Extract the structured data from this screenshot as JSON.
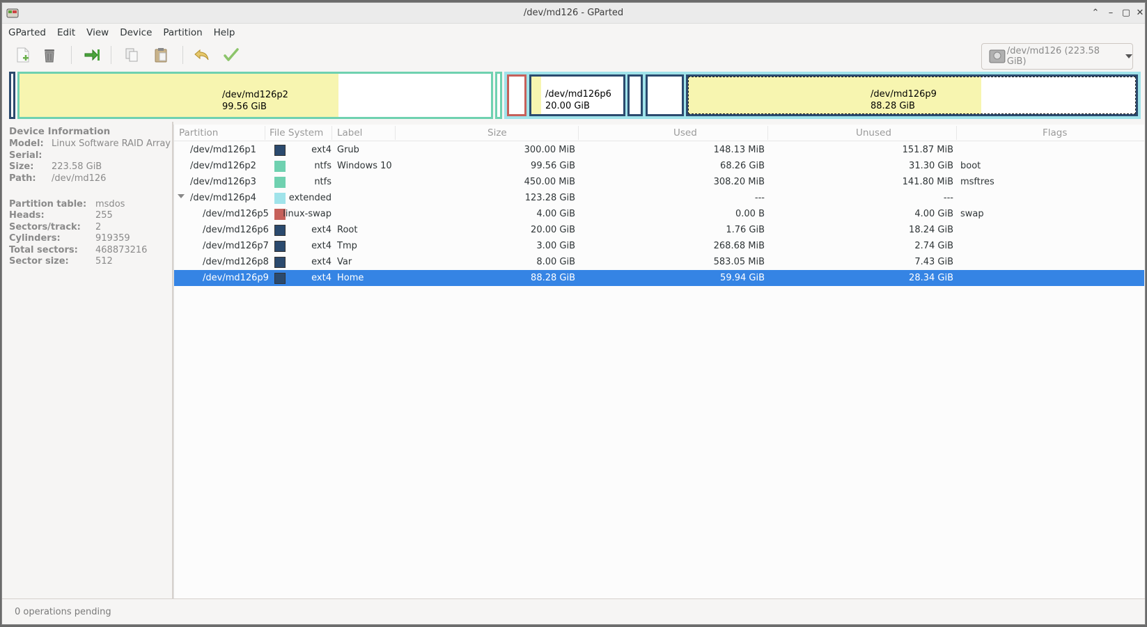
{
  "window": {
    "title": "/dev/md126 - GParted"
  },
  "menubar": {
    "items": [
      "GParted",
      "Edit",
      "View",
      "Device",
      "Partition",
      "Help"
    ]
  },
  "toolbar": {
    "buttons": [
      "new-icon",
      "delete-icon",
      "resize-move-icon",
      "copy-icon",
      "paste-icon",
      "undo-icon",
      "apply-icon"
    ],
    "device_label": "/dev/md126 (223.58 GiB)"
  },
  "partition_bar": {
    "p2": {
      "name": "/dev/md126p2",
      "size": "99.56 GiB"
    },
    "p6": {
      "name": "/dev/md126p6",
      "size": "20.00 GiB"
    },
    "p9": {
      "name": "/dev/md126p9",
      "size": "88.28 GiB"
    }
  },
  "device_info": {
    "title": "Device Information",
    "model_label": "Model:",
    "model": "Linux Software RAID Array",
    "serial_label": "Serial:",
    "serial": "",
    "size_label": "Size:",
    "size": "223.58 GiB",
    "path_label": "Path:",
    "path": "/dev/md126",
    "ptable_label": "Partition table:",
    "ptable": "msdos",
    "heads_label": "Heads:",
    "heads": "255",
    "sectors_track_label": "Sectors/track:",
    "sectors_track": "2",
    "cylinders_label": "Cylinders:",
    "cylinders": "919359",
    "total_sectors_label": "Total sectors:",
    "total_sectors": "468873216",
    "sector_size_label": "Sector size:",
    "sector_size": "512"
  },
  "table": {
    "headers": {
      "partition": "Partition",
      "fs": "File System",
      "label": "Label",
      "size": "Size",
      "used": "Used",
      "unused": "Unused",
      "flags": "Flags"
    },
    "rows": [
      {
        "partition": "/dev/md126p1",
        "fs": "ext4",
        "color": "#2b4a6e",
        "label": "Grub",
        "size": "300.00 MiB",
        "used": "148.13 MiB",
        "unused": "151.87 MiB",
        "flags": ""
      },
      {
        "partition": "/dev/md126p2",
        "fs": "ntfs",
        "color": "#6fd1b0",
        "label": "Windows 10",
        "size": "99.56 GiB",
        "used": "68.26 GiB",
        "unused": "31.30 GiB",
        "flags": "boot"
      },
      {
        "partition": "/dev/md126p3",
        "fs": "ntfs",
        "color": "#6fd1b0",
        "label": "",
        "size": "450.00 MiB",
        "used": "308.20 MiB",
        "unused": "141.80 MiB",
        "flags": "msftres"
      },
      {
        "partition": "/dev/md126p4",
        "fs": "extended",
        "color": "#a0e3ea",
        "label": "",
        "size": "123.28 GiB",
        "used": "---",
        "unused": "---",
        "flags": ""
      },
      {
        "partition": "/dev/md126p5",
        "fs": "linux-swap",
        "color": "#c6605a",
        "label": "",
        "size": "4.00 GiB",
        "used": "0.00 B",
        "unused": "4.00 GiB",
        "flags": "swap"
      },
      {
        "partition": "/dev/md126p6",
        "fs": "ext4",
        "color": "#2b4a6e",
        "label": "Root",
        "size": "20.00 GiB",
        "used": "1.76 GiB",
        "unused": "18.24 GiB",
        "flags": ""
      },
      {
        "partition": "/dev/md126p7",
        "fs": "ext4",
        "color": "#2b4a6e",
        "label": "Tmp",
        "size": "3.00 GiB",
        "used": "268.68 MiB",
        "unused": "2.74 GiB",
        "flags": ""
      },
      {
        "partition": "/dev/md126p8",
        "fs": "ext4",
        "color": "#2b4a6e",
        "label": "Var",
        "size": "8.00 GiB",
        "used": "583.05 MiB",
        "unused": "7.43 GiB",
        "flags": ""
      },
      {
        "partition": "/dev/md126p9",
        "fs": "ext4",
        "color": "#2b4a6e",
        "label": "Home",
        "size": "88.28 GiB",
        "used": "59.94 GiB",
        "unused": "28.34 GiB",
        "flags": ""
      }
    ]
  },
  "status": {
    "text": "0 operations pending"
  }
}
